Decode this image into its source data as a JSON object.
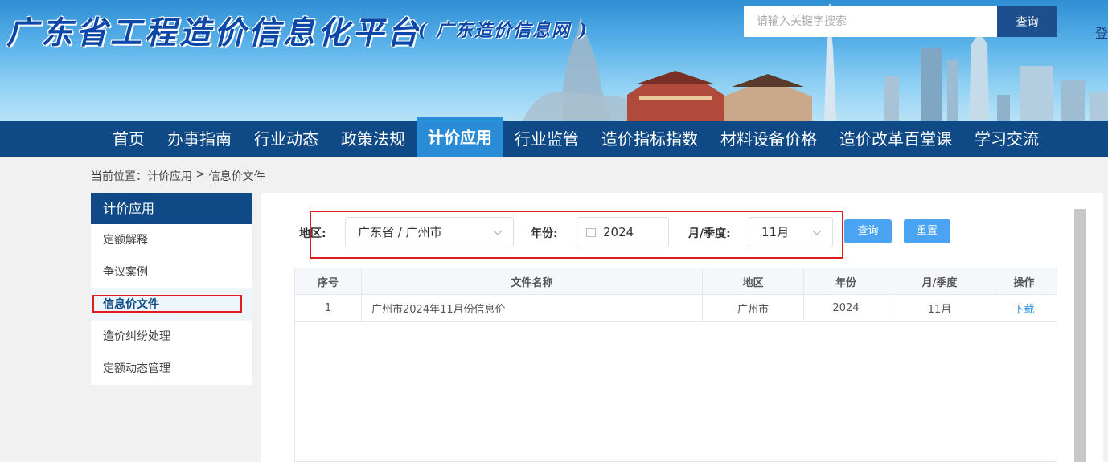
{
  "header": {
    "site_title": "广东省工程造价信息化平台",
    "site_subtitle": "( 广东造价信息网 )",
    "search_placeholder": "请输入关键字搜索",
    "search_button": "查询",
    "login_text": "登"
  },
  "nav": {
    "items": [
      {
        "label": "首页"
      },
      {
        "label": "办事指南"
      },
      {
        "label": "行业动态"
      },
      {
        "label": "政策法规"
      },
      {
        "label": "计价应用",
        "active": true
      },
      {
        "label": "行业监管"
      },
      {
        "label": "造价指标指数"
      },
      {
        "label": "材料设备价格"
      },
      {
        "label": "造价改革百堂课"
      },
      {
        "label": "学习交流"
      }
    ]
  },
  "breadcrumb": {
    "prefix": "当前位置：",
    "level1": "计价应用",
    "separator": " > ",
    "level2": "信息价文件"
  },
  "sidebar": {
    "heading": "计价应用",
    "items": [
      {
        "label": "定额解释"
      },
      {
        "label": "争议案例"
      },
      {
        "label": "信息价文件",
        "active": true
      },
      {
        "label": "造价纠纷处理"
      },
      {
        "label": "定额动态管理"
      }
    ]
  },
  "filters": {
    "region_label": "地区:",
    "region_value": "广东省 / 广州市",
    "year_label": "年份:",
    "year_value": "2024",
    "period_label": "月/季度:",
    "period_value": "11月",
    "query_button": "查询",
    "reset_button": "重置"
  },
  "table": {
    "headers": [
      "序号",
      "文件名称",
      "地区",
      "年份",
      "月/季度",
      "操作"
    ],
    "rows": [
      [
        "1",
        "广州市2024年11月份信息价",
        "广州市",
        "2024",
        "11月",
        "下载"
      ]
    ]
  },
  "colors": {
    "nav_bg": "#0f4a87",
    "nav_active": "#2a8bd6",
    "button_blue": "#4aa3f3",
    "highlight_red": "#e01c1c",
    "link_blue": "#2b8ee0"
  }
}
